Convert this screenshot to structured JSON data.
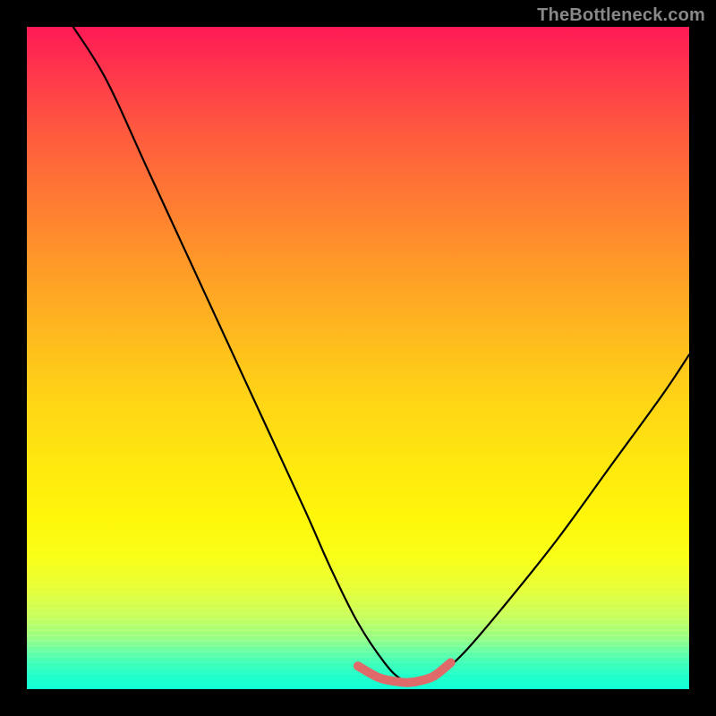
{
  "watermark": "TheBottleneck.com",
  "chart_data": {
    "type": "line",
    "title": "",
    "xlabel": "",
    "ylabel": "",
    "xlim": [
      0,
      1
    ],
    "ylim": [
      0,
      1
    ],
    "grid": false,
    "legend": null,
    "series": [
      {
        "name": "main-curve",
        "color": "#000000",
        "x": [
          0.07,
          0.12,
          0.18,
          0.24,
          0.3,
          0.36,
          0.42,
          0.46,
          0.5,
          0.54,
          0.565,
          0.585,
          0.6,
          0.62,
          0.66,
          0.72,
          0.8,
          0.88,
          0.96,
          1.0
        ],
        "y": [
          1.0,
          0.92,
          0.79,
          0.66,
          0.53,
          0.4,
          0.27,
          0.18,
          0.1,
          0.04,
          0.015,
          0.01,
          0.012,
          0.02,
          0.055,
          0.125,
          0.225,
          0.335,
          0.445,
          0.505
        ]
      },
      {
        "name": "highlight-segment",
        "color": "#e06a6a",
        "x": [
          0.5,
          0.53,
          0.555,
          0.575,
          0.595,
          0.615,
          0.64
        ],
        "y": [
          0.035,
          0.018,
          0.012,
          0.01,
          0.013,
          0.02,
          0.04
        ]
      }
    ],
    "background_gradient": {
      "top": "#ff1a55",
      "mid": "#ffe80f",
      "bottom": "#10ffd4"
    }
  }
}
